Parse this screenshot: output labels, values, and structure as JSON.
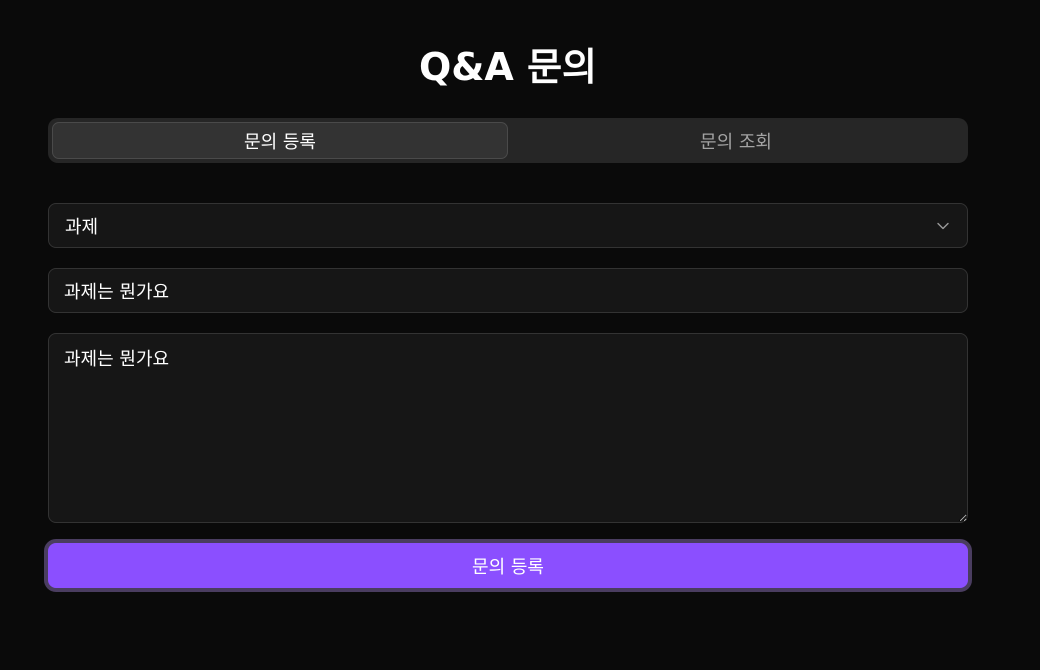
{
  "page": {
    "title": "Q&A 문의"
  },
  "tabs": [
    {
      "label": "문의 등록",
      "active": true
    },
    {
      "label": "문의 조회",
      "active": false
    }
  ],
  "form": {
    "category": {
      "selected": "과제",
      "icon": "chevron-down-icon"
    },
    "subject": {
      "value": "과제는 뭔가요"
    },
    "content": {
      "value": "과제는 뭔가요"
    },
    "submit_label": "문의 등록"
  },
  "colors": {
    "background": "#0a0a0a",
    "accent": "#8b4fff",
    "field_bg": "#161616",
    "field_border": "#333333"
  }
}
